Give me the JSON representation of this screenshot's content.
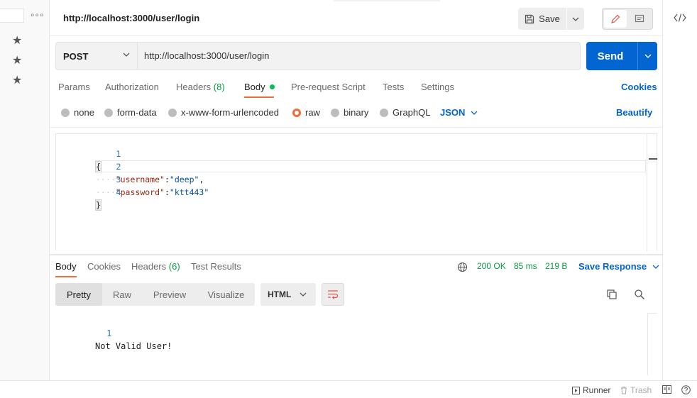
{
  "header": {
    "title": "http://localhost:3000/user/login",
    "save_label": "Save"
  },
  "request": {
    "method": "POST",
    "url": "http://localhost:3000/user/login",
    "send_label": "Send"
  },
  "request_tabs": {
    "params": "Params",
    "authorization": "Authorization",
    "headers": "Headers",
    "headers_count": "(8)",
    "body": "Body",
    "pre_request": "Pre-request Script",
    "tests": "Tests",
    "settings": "Settings",
    "cookies": "Cookies"
  },
  "body_options": {
    "none": "none",
    "form_data": "form-data",
    "urlencoded": "x-www-form-urlencoded",
    "raw": "raw",
    "binary": "binary",
    "graphql": "GraphQL",
    "language": "JSON",
    "beautify": "Beautify",
    "selected": "raw"
  },
  "editor": {
    "lines": [
      {
        "num": "1",
        "text": "{"
      },
      {
        "num": "2",
        "indent": "····",
        "key": "\"username\"",
        "sep": ":",
        "value": "\"deep\"",
        "tail": ","
      },
      {
        "num": "3",
        "indent": "····",
        "key": "\"password\"",
        "sep": ":",
        "value": "\"ktt443\"",
        "tail": ""
      },
      {
        "num": "4",
        "text": "}"
      }
    ]
  },
  "response": {
    "tabs": {
      "body": "Body",
      "cookies": "Cookies",
      "headers": "Headers",
      "headers_count": "(6)",
      "test_results": "Test Results"
    },
    "status": "200 OK",
    "time": "85 ms",
    "size": "219 B",
    "save_response": "Save Response",
    "formats": {
      "pretty": "Pretty",
      "raw": "Raw",
      "preview": "Preview",
      "visualize": "Visualize"
    },
    "language": "HTML",
    "lines": [
      {
        "num": "1",
        "text": "Not Valid User!"
      }
    ]
  },
  "footer": {
    "runner": "Runner",
    "trash": "Trash"
  },
  "colors": {
    "accent_orange": "#f26b3a",
    "primary_blue": "#0265d2",
    "status_green": "#0a9b45"
  }
}
